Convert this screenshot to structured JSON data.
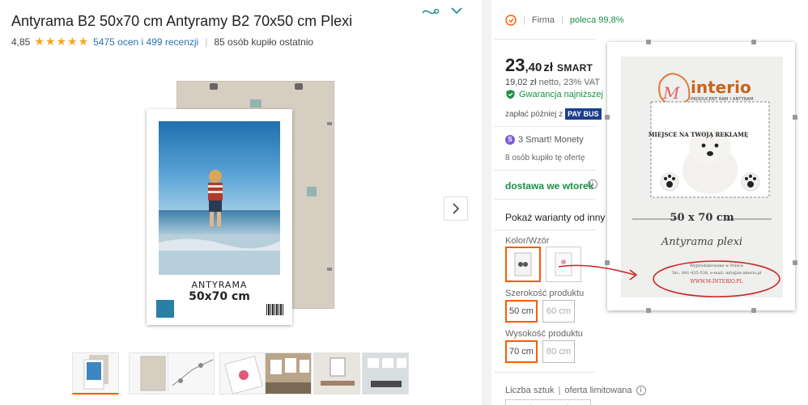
{
  "product": {
    "title": "Antyrama B2 50x70 cm Antyramy B2 70x50 cm Plexi",
    "rating": "4,85",
    "stars": "★★★★★",
    "reviews": "5475 ocen i 499 recenzji",
    "bought_recently": "85 osób kupiło ostatnio"
  },
  "gallery": {
    "poster_caption": "Antyrama",
    "poster_size": "50x70 cm",
    "thumbnail_count": 8
  },
  "seller": {
    "type": "Firma",
    "recommend": "poleca 99,8%"
  },
  "offer": {
    "price_int": "23",
    "price_dec": ",40",
    "currency": "zł",
    "smart_badge": "SMART",
    "net_price": "19,02 zł",
    "net_note": "netto, 23% VAT",
    "guarantee": "Gwarancja najniższej",
    "pay_later": "zapłać później z",
    "pay_badge": "PAY BUS",
    "smart_coins": "3 Smart! Monety",
    "bought": "8 osób kupiło tę ofertę",
    "delivery": "dostawa we wtorek",
    "show_variants": "Pokaż warianty od inny"
  },
  "attributes": {
    "color_label": "Kolor/Wzór",
    "width_label": "Szerokość produktu",
    "width_options": [
      "50 cm",
      "60 cm"
    ],
    "height_label": "Wysokość produktu",
    "height_options": [
      "70 cm",
      "80 cm"
    ]
  },
  "quantity": {
    "label": "Liczba sztuk",
    "limited": "oferta limitowana"
  },
  "zoom": {
    "brand": "interio",
    "brand_sub": "PRODUCENT RAM I ANTYRAM",
    "ad_text": "MIEJSCE NA TWOJĄ REKLAMĘ",
    "size": "50 x 70 cm",
    "product_name": "Antyrama plexi",
    "made_in": "Wyprodukowane w Polsce",
    "contact": "Tel.: 881-435-538, e-mail: info@m-interio.pl",
    "url": "WWW.M-INTERIO.PL"
  },
  "colors": {
    "accent": "#ff5a00",
    "green": "#1a8f47",
    "link": "#2a72b5",
    "star": "#f5a623"
  }
}
